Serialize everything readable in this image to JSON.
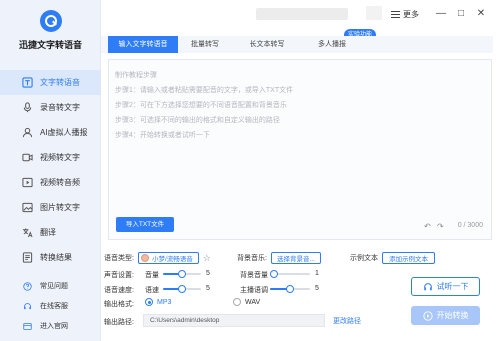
{
  "app": {
    "title": "迅捷文字转语音",
    "menu_label": "更多",
    "minimize": "—",
    "maximize": "□",
    "close": "✕"
  },
  "sidebar": {
    "items": [
      {
        "label": "文字转语音",
        "icon": "text-to-speech-icon",
        "active": true
      },
      {
        "label": "录音转文字",
        "icon": "recording-icon",
        "active": false
      },
      {
        "label": "AI虚拟人播报",
        "icon": "ai-avatar-icon",
        "active": false
      },
      {
        "label": "视频转文字",
        "icon": "video-to-text-icon",
        "active": false
      },
      {
        "label": "视频转音频",
        "icon": "video-to-audio-icon",
        "active": false
      },
      {
        "label": "图片转文字",
        "icon": "image-to-text-icon",
        "active": false
      },
      {
        "label": "翻译",
        "icon": "translate-icon",
        "active": false
      },
      {
        "label": "转换结果",
        "icon": "results-icon",
        "active": false
      }
    ],
    "bottom": [
      {
        "label": "常见问题",
        "icon": "faq-icon"
      },
      {
        "label": "在线客服",
        "icon": "support-icon"
      },
      {
        "label": "进入官网",
        "icon": "website-icon"
      }
    ]
  },
  "tabs": [
    {
      "label": "输入文字转语音",
      "active": true
    },
    {
      "label": "批量转写",
      "active": false
    },
    {
      "label": "长文本转写",
      "active": false
    },
    {
      "label": "多人播报",
      "active": false
    }
  ],
  "tab_badge": "实验功能",
  "editor": {
    "steps": [
      "制作教程步骤",
      "步骤1：请输入或者粘贴需要配音的文字，或导入TXT文件",
      "步骤2：可在下方选择您想要的不同语音配置和背景音乐",
      "步骤3：可选择不同的输出的格式和自定义输出的路径",
      "步骤4：开始转换或者试听一下"
    ],
    "import_label": "导入TXT文件",
    "undo": "↶",
    "redo": "↷",
    "count": "0 / 3000"
  },
  "settings": {
    "voice_label": "语音类型:",
    "voice_value": "小梦/流畅语音",
    "bg_music_label": "背景音乐:",
    "bg_music_btn": "选择背景音...",
    "sample_label": "示例文本",
    "sample_btn": "添加示例文本",
    "voice_setting_label": "声音设置:",
    "volume_label": "音量",
    "volume_value": "5",
    "bg_volume_label": "背景音量",
    "bg_volume_value": "1",
    "speed_label": "语音速度:",
    "speed_sub_label": "语速",
    "speed_value": "5",
    "pitch_label": "主播语调",
    "pitch_value": "5",
    "format_label": "输出格式:",
    "format_options": [
      "MP3",
      "WAV"
    ],
    "format_selected": "MP3",
    "path_label": "输出路径:",
    "path_value": "C:\\Users\\admin\\desktop",
    "change_path": "更改路径",
    "listen_btn": "试听一下",
    "convert_btn": "开始转换"
  },
  "sliders": {
    "volume": 0.5,
    "bg_volume": 0.1,
    "speed": 0.5,
    "pitch": 0.5
  },
  "colors": {
    "accent": "#2f7df6",
    "sidebar_bg": "#eef3fb",
    "active_item_bg": "#dbe8fb",
    "convert_disabled": "#a8c7f8"
  }
}
